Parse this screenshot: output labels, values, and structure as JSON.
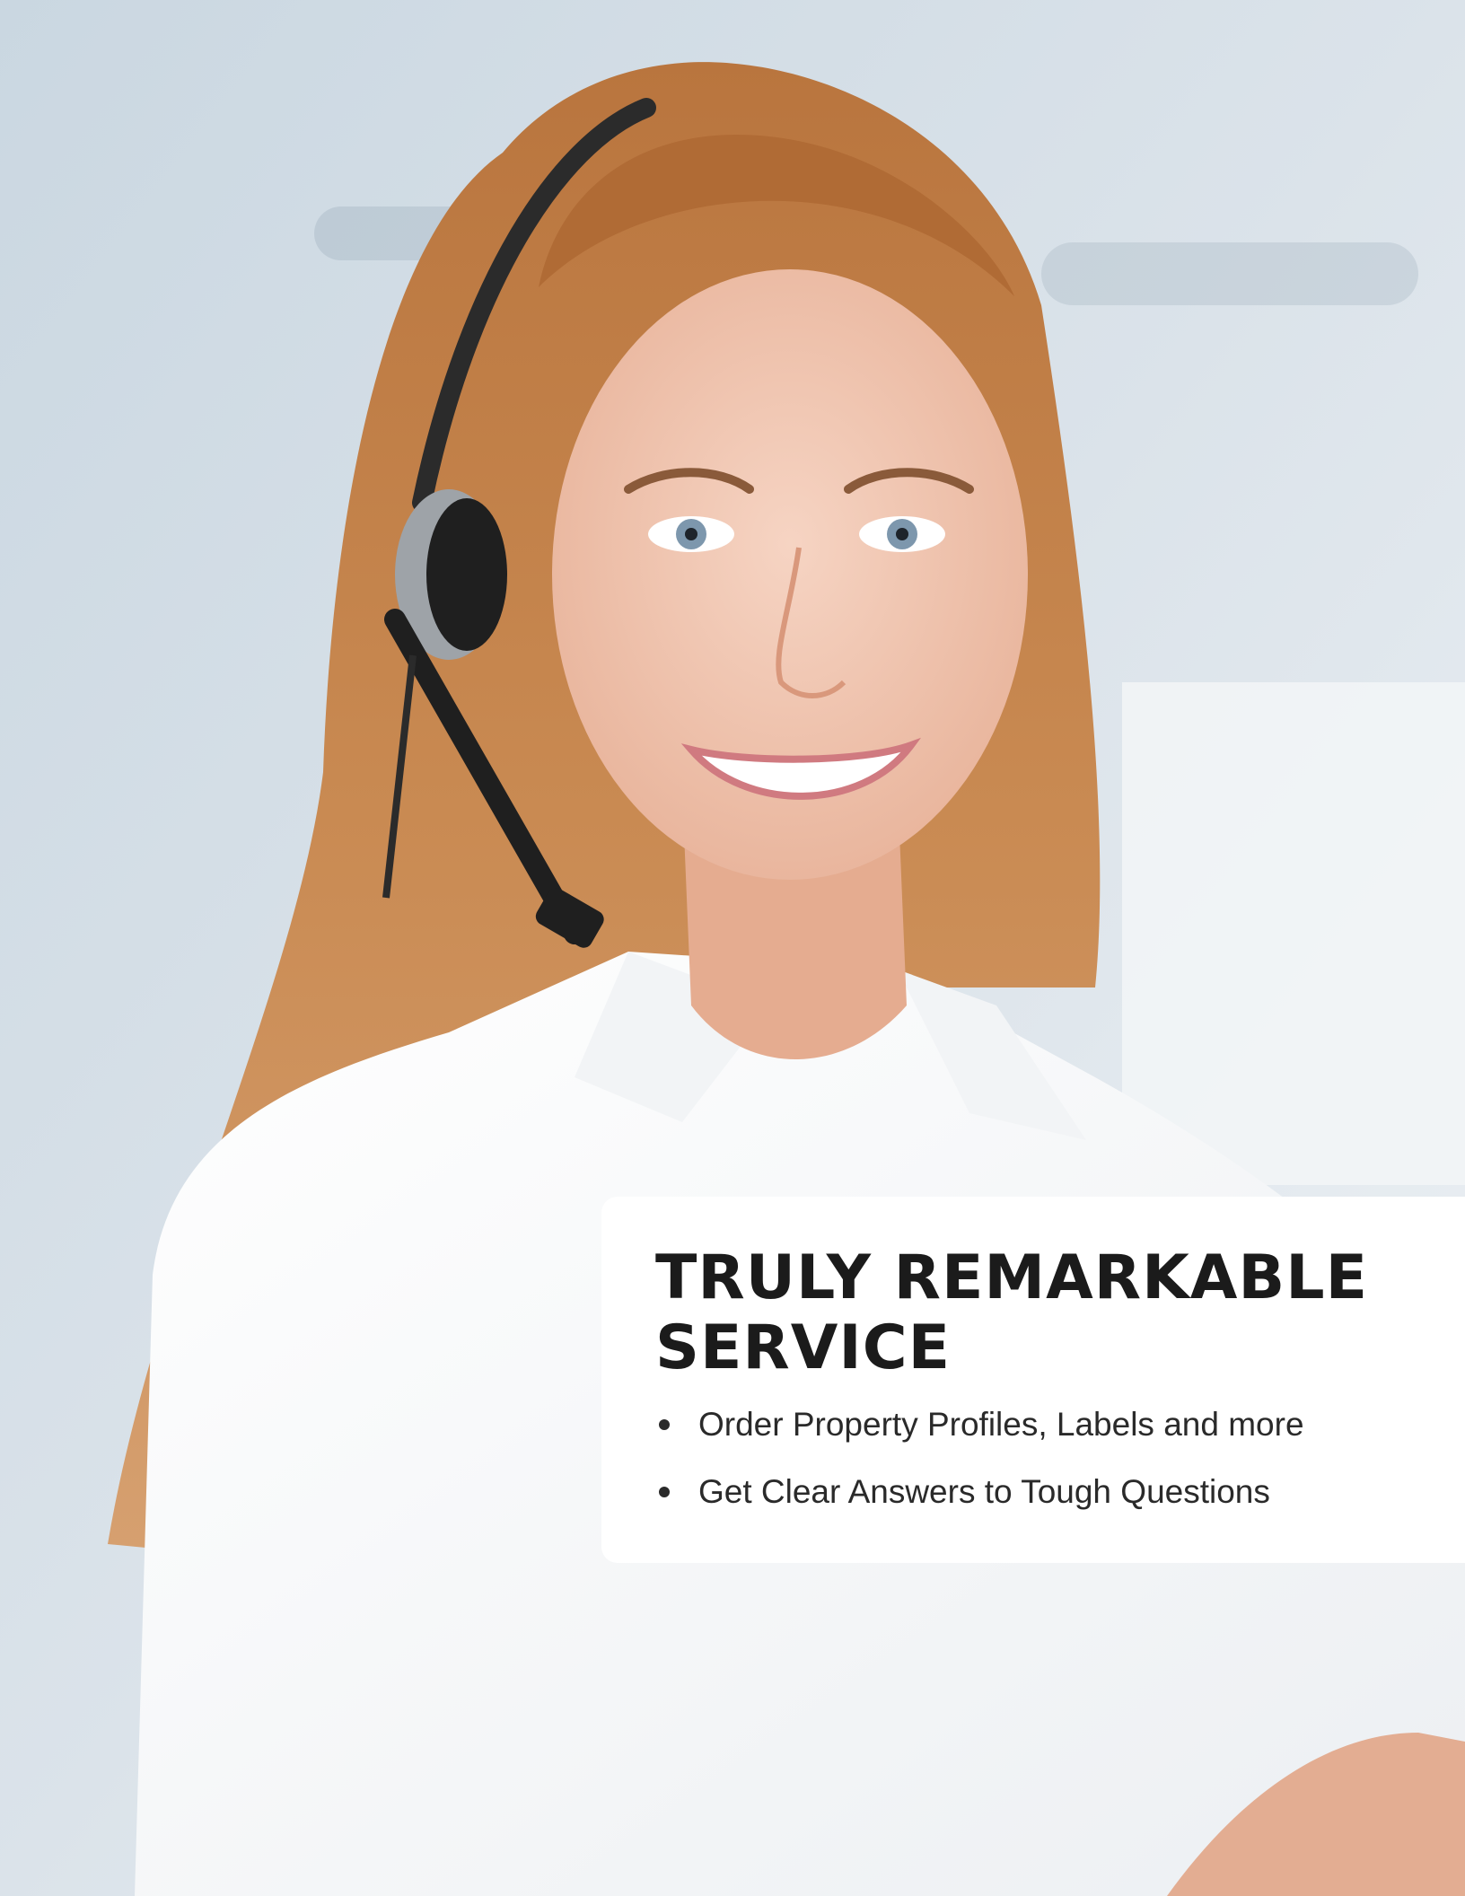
{
  "hero": {
    "image_subject": "customer-service-representative-photo"
  },
  "card": {
    "headline_line1": "TRULY REMARKABLE",
    "headline_line2": "SERVICE",
    "bullets": [
      "Order Property Profiles, Labels and more",
      "Get Clear Answers to Tough Questions"
    ]
  },
  "colors": {
    "background": "#dde5ec",
    "card": "#ffffff",
    "text": "#1b1b1b"
  }
}
